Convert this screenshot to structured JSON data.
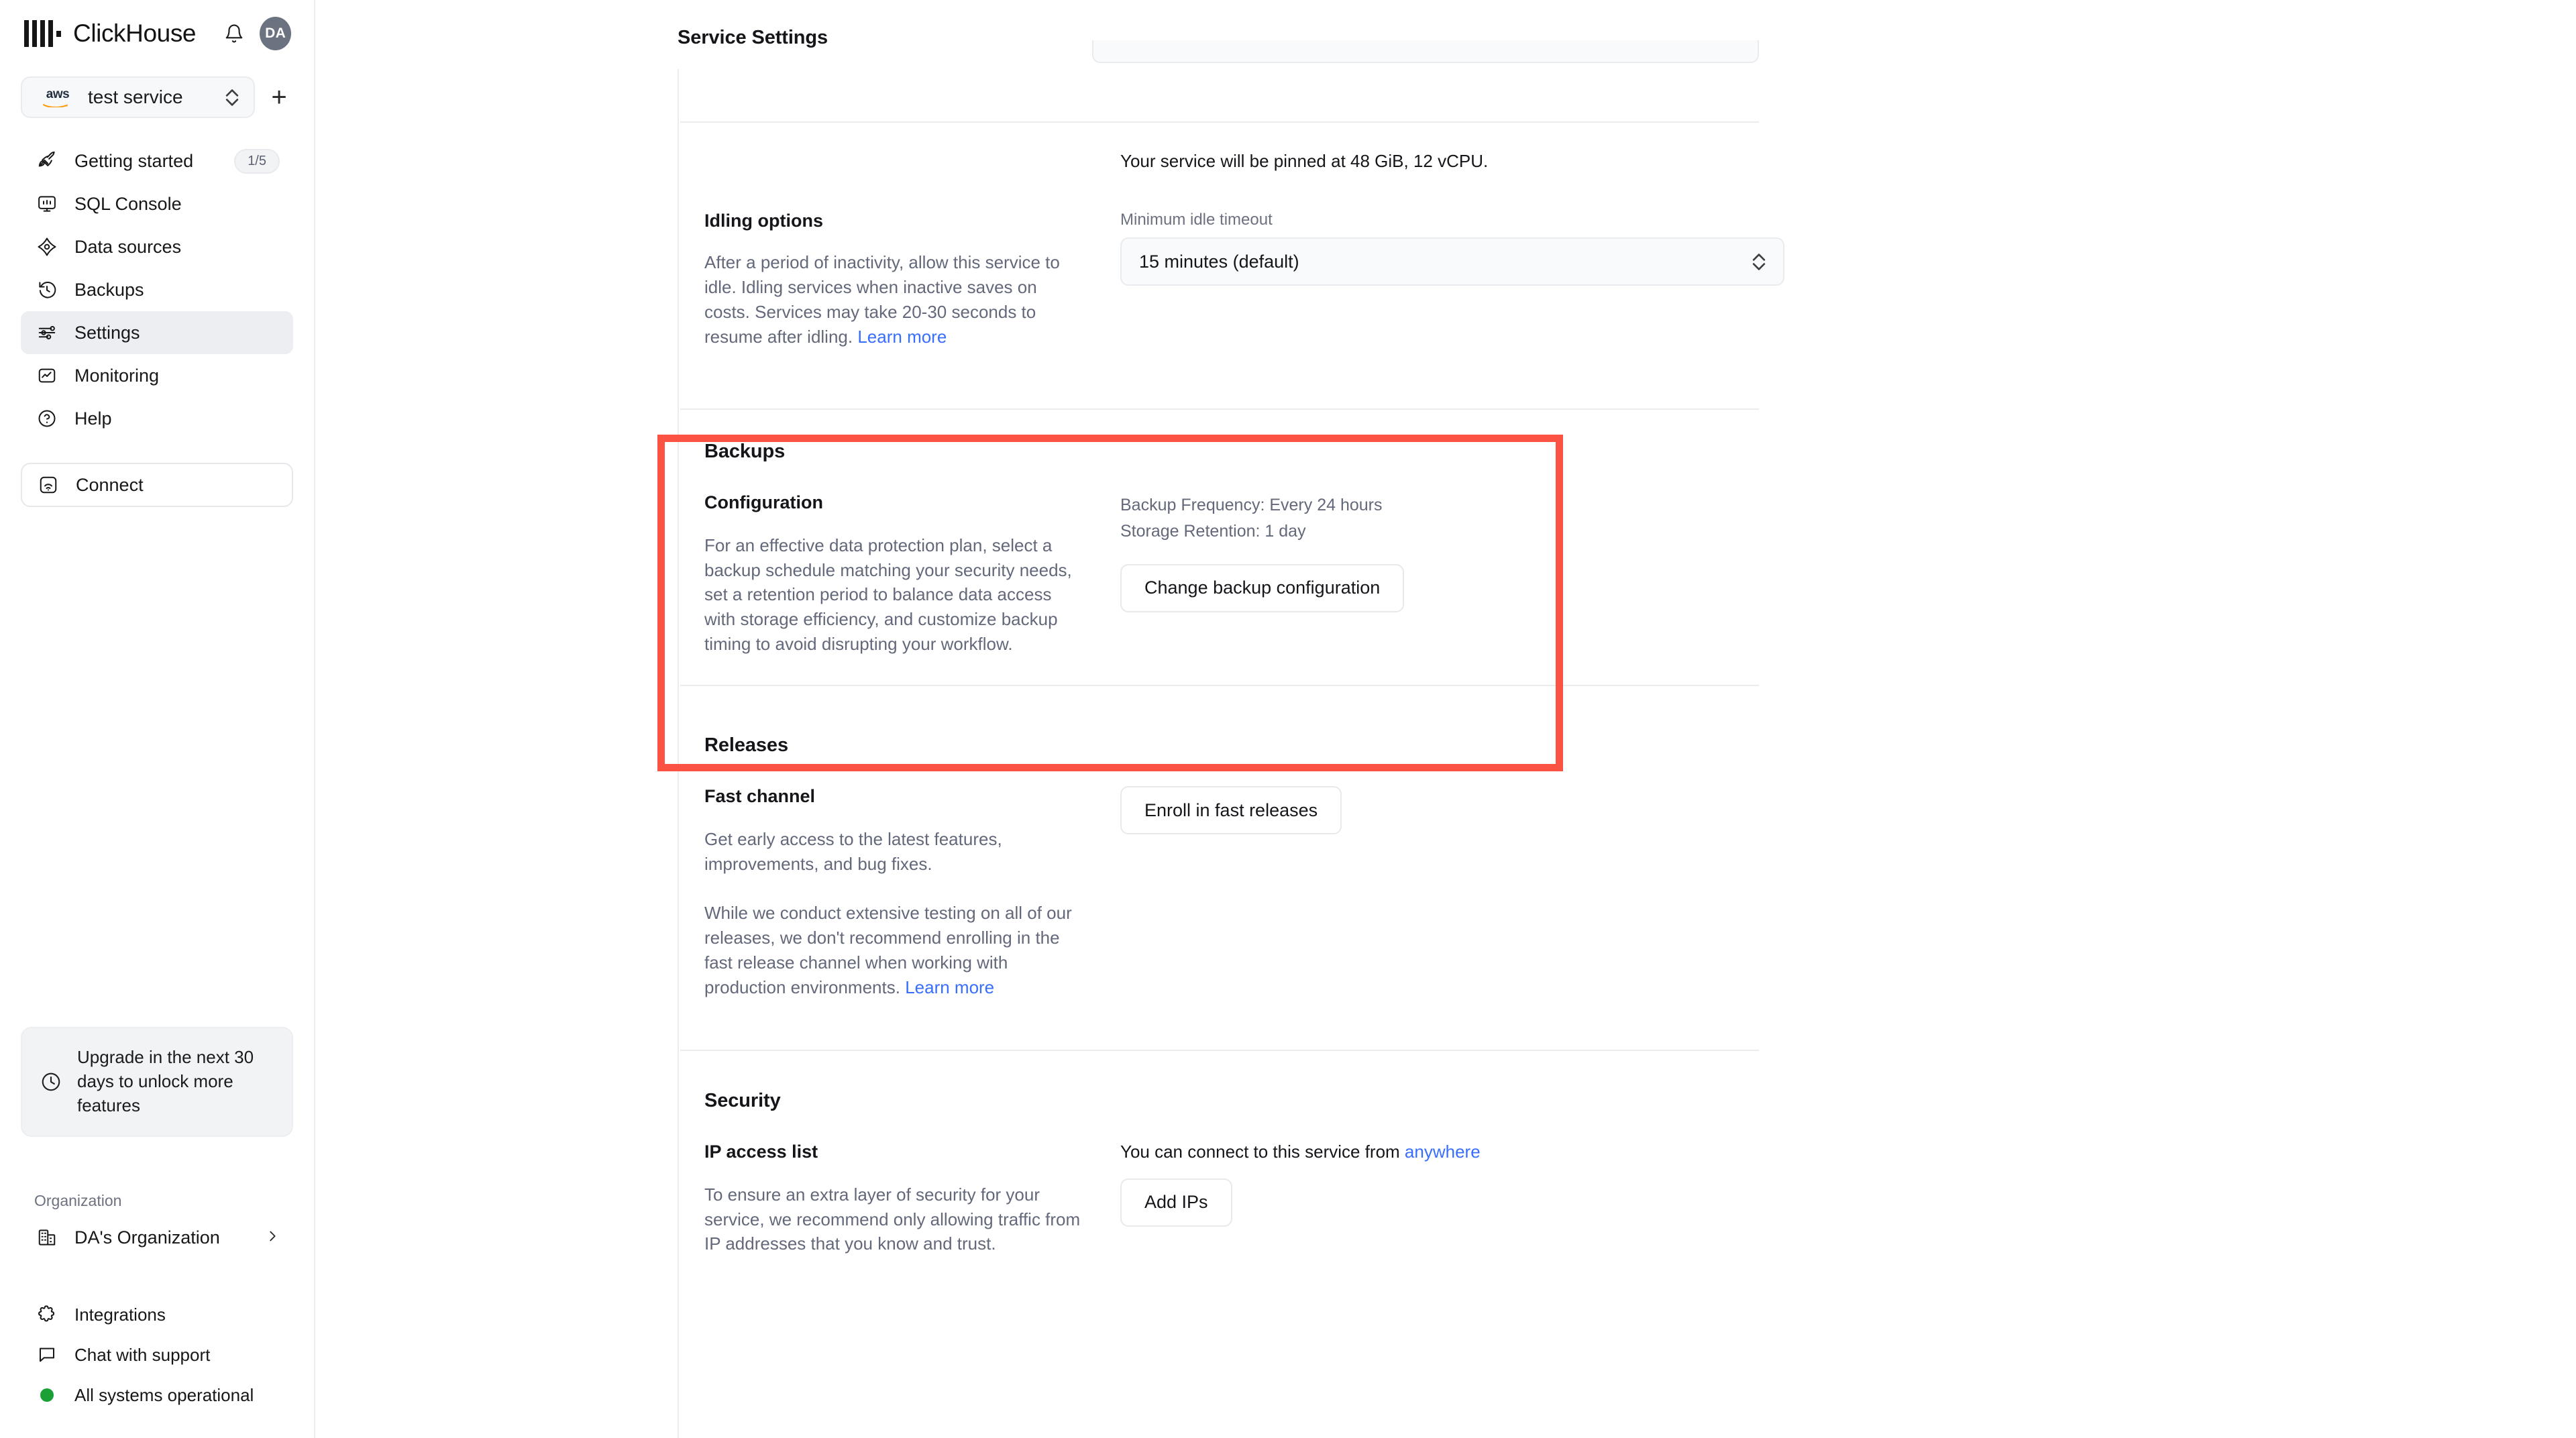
{
  "brand": {
    "name": "ClickHouse",
    "avatar_initials": "DA",
    "bell_icon": "bell-icon"
  },
  "service_selector": {
    "cloud_provider": "aws",
    "service_name": "test service",
    "add_label": "+"
  },
  "sidebar": {
    "nav": [
      {
        "label": "Getting started",
        "icon": "rocket-icon",
        "badge": "1/5",
        "active": false
      },
      {
        "label": "SQL Console",
        "icon": "console-icon",
        "badge": "",
        "active": false
      },
      {
        "label": "Data sources",
        "icon": "data-sources-icon",
        "badge": "",
        "active": false
      },
      {
        "label": "Backups",
        "icon": "history-icon",
        "badge": "",
        "active": false
      },
      {
        "label": "Settings",
        "icon": "sliders-icon",
        "badge": "",
        "active": true
      },
      {
        "label": "Monitoring",
        "icon": "chart-icon",
        "badge": "",
        "active": false
      },
      {
        "label": "Help",
        "icon": "question-circle-icon",
        "badge": "",
        "active": false
      }
    ],
    "connect": {
      "label": "Connect",
      "icon": "connect-icon"
    },
    "upgrade": {
      "text": "Upgrade in the next 30 days to unlock more features",
      "icon": "clock-icon"
    },
    "organization": {
      "heading": "Organization",
      "name": "DA's Organization",
      "icon": "building-icon",
      "chevron": "chevron-right-icon"
    },
    "footer": [
      {
        "label": "Integrations",
        "icon": "puzzle-icon"
      },
      {
        "label": "Chat with support",
        "icon": "chat-bubble-icon"
      },
      {
        "label": "All systems operational",
        "icon": "status-dot-icon"
      }
    ],
    "status_color": "#1ba037"
  },
  "main": {
    "page_title": "Service Settings",
    "scaling_note": "Your service will be pinned at 48 GiB, 12 vCPU.",
    "idling": {
      "title": "Idling options",
      "description": "After a period of inactivity, allow this service to idle. Idling services when inactive saves on costs. Services may take 20-30 seconds to resume after idling.",
      "learn_more": "Learn more",
      "field_label": "Minimum idle timeout",
      "selected_value": "15 minutes (default)"
    },
    "backups": {
      "title": "Backups",
      "sub_title": "Configuration",
      "description": "For an effective data protection plan, select a backup schedule matching your security needs, set a retention period to balance data access with storage efficiency, and customize backup timing to avoid disrupting your workflow.",
      "frequency": "Backup Frequency: Every 24 hours",
      "retention": "Storage Retention: 1 day",
      "change_button": "Change backup configuration",
      "highlight_color": "#fb5343"
    },
    "releases": {
      "title": "Releases",
      "sub_title": "Fast channel",
      "description_1": "Get early access to the latest features, improvements, and bug fixes.",
      "description_2": "While we conduct extensive testing on all of our releases, we don't recommend enrolling in the fast release channel when working with production environments.",
      "learn_more": "Learn more",
      "enroll_button": "Enroll in fast releases"
    },
    "security": {
      "title": "Security",
      "sub_title": "IP access list",
      "description": "To ensure an extra layer of security for your service, we recommend only allowing traffic from IP addresses that you know and trust.",
      "connect_note_prefix": "You can connect to this service from ",
      "connect_note_link": "anywhere",
      "add_ips_button": "Add IPs"
    },
    "link_color": "#386efb"
  }
}
